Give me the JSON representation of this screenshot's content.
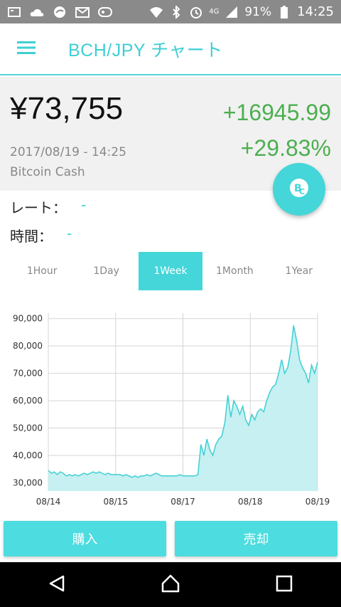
{
  "status_bar": {
    "battery": "91%",
    "time": "14:25",
    "network": "4G",
    "icons": [
      "notification-icon",
      "cloud-icon",
      "sync-icon",
      "mail-icon",
      "app-icon",
      "wifi-icon",
      "bluetooth-icon",
      "alarm-icon",
      "signal-icon",
      "battery-icon"
    ]
  },
  "app_bar": {
    "title": "BCH/JPY チャート",
    "menu_icon": "hamburger-menu-icon"
  },
  "summary": {
    "price": "¥73,755",
    "change_abs": "+16945.99",
    "change_pct": "+29.83%",
    "datetime": "2017/08/19 - 14:25",
    "coin_name": "Bitcoin Cash",
    "colors": {
      "positive": "#4caf50",
      "accent": "#44d6d9"
    }
  },
  "info": {
    "rate_label": "レート：",
    "rate_value": "-",
    "time_label": "時間：",
    "time_value": "-"
  },
  "ranges": [
    {
      "label": "1Hour",
      "active": false
    },
    {
      "label": "1Day",
      "active": false
    },
    {
      "label": "1Week",
      "active": true
    },
    {
      "label": "1Month",
      "active": false
    },
    {
      "label": "1Year",
      "active": false
    }
  ],
  "chart_data": {
    "type": "area",
    "ylim": [
      27000,
      92000
    ],
    "yticks": [
      "90,000",
      "80,000",
      "70,000",
      "60,000",
      "50,000",
      "40,000",
      "30,000"
    ],
    "ytick_values": [
      90000,
      80000,
      70000,
      60000,
      50000,
      40000,
      30000
    ],
    "xticks": [
      "08/14",
      "08/15",
      "08/17",
      "08/18",
      "08/19"
    ],
    "grid": true,
    "series": [
      {
        "values": [
          34500,
          33500,
          34000,
          33000,
          34000,
          33500,
          32500,
          33000,
          32500,
          33000,
          32500,
          33000,
          33500,
          33000,
          33500,
          34000,
          33500,
          34000,
          33500,
          33000,
          33500,
          33000,
          33000,
          33000,
          33000,
          32500,
          33000,
          32500,
          32000,
          32500,
          32000,
          32500,
          32500,
          33000,
          32500,
          33000,
          33500,
          33000,
          32500,
          32500,
          32500,
          32500,
          32500,
          32500,
          33000,
          32500,
          32500,
          32500,
          32500,
          32500,
          33000,
          44000,
          40000,
          46000,
          42000,
          40000,
          44000,
          46000,
          47000,
          52000,
          62000,
          54000,
          60000,
          58000,
          55000,
          58000,
          53000,
          51000,
          55000,
          53000,
          56000,
          57000,
          56000,
          60000,
          63000,
          65000,
          66000,
          70000,
          75000,
          70000,
          72000,
          78000,
          87500,
          82000,
          75000,
          72000,
          70000,
          66500,
          73000,
          70000,
          74000
        ]
      }
    ],
    "colors": {
      "line": "#3ecfd4",
      "fill": "#c6f0f1",
      "grid": "#d5d5d5"
    }
  },
  "actions": {
    "buy": "購入",
    "sell": "売却"
  },
  "nav": {
    "icons": [
      "back-icon",
      "home-icon",
      "recents-icon"
    ]
  }
}
